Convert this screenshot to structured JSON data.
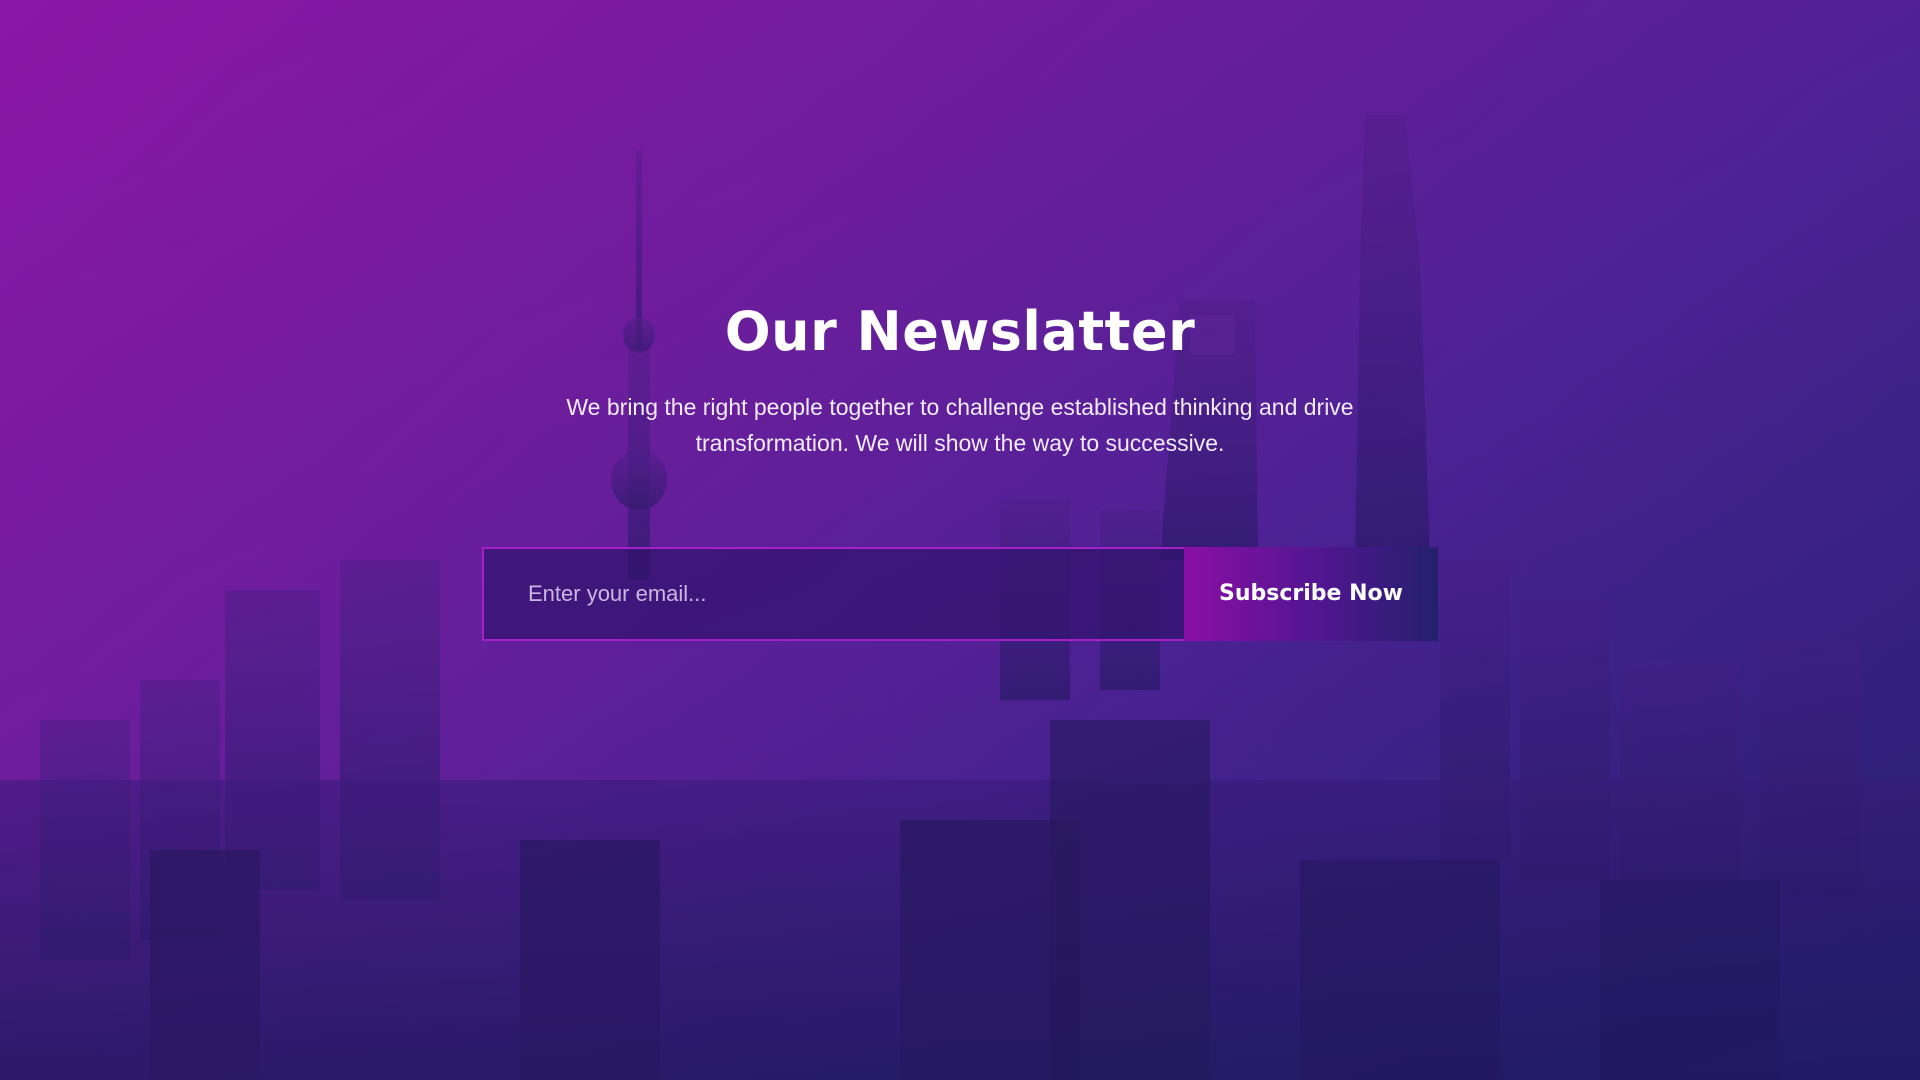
{
  "newsletter": {
    "title": "Our Newslatter",
    "description": "We bring the right people together to challenge established thinking and drive transformation. We will show the way to successive.",
    "email_placeholder": "Enter your email...",
    "email_value": "",
    "subscribe_label": "Subscribe Now"
  },
  "theme": {
    "gradient_start": "#8a18a8",
    "gradient_end": "#2b2273",
    "input_border": "#a321c7",
    "text": "#ffffff"
  },
  "background": {
    "image_subject": "city-skyline-at-dusk"
  }
}
